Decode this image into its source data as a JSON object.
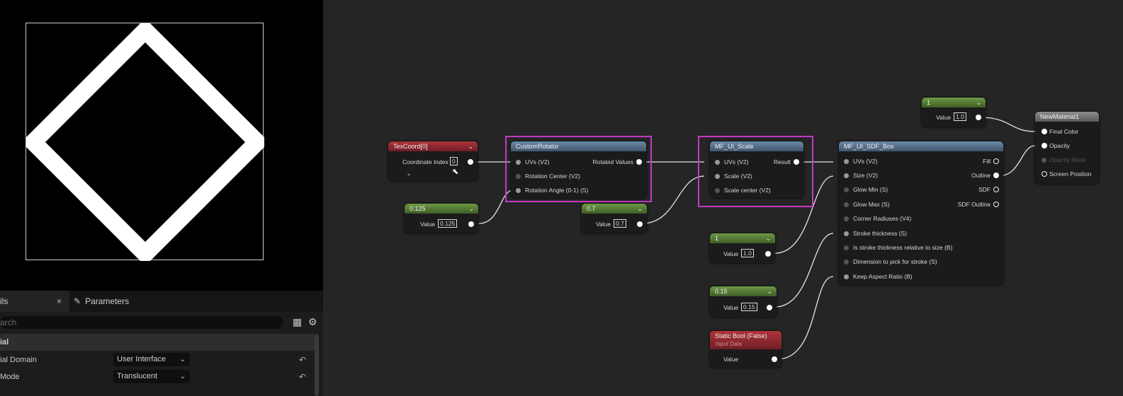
{
  "details_panel": {
    "tab_details": "ils",
    "tab_close": "×",
    "tab_parameters": "Parameters",
    "search_placeholder": "arch",
    "section": "ial",
    "rows": [
      {
        "label": "ial Domain",
        "value": "User Interface"
      },
      {
        "label": "Mode",
        "value": "Translucent"
      }
    ]
  },
  "nodes": {
    "texcoord": {
      "title": "TexCoord[0]",
      "pin": "Coordinate Index",
      "value": "0",
      "expand": "⌄"
    },
    "custom_rotator": {
      "title": "CustomRotator",
      "inputs": [
        "UVs (V2)",
        "Rotation Center (V2)",
        "Rotation Angle (0-1) (S)"
      ],
      "output": "Rotated Values"
    },
    "const_0125": {
      "title": "0.125",
      "pin": "Value",
      "value": "0.125"
    },
    "const_07": {
      "title": "0.7",
      "pin": "Value",
      "value": "0.7"
    },
    "mf_ui_scale": {
      "title": "MF_UI_Scale",
      "inputs": [
        "UVs (V2)",
        "Scale (V2)",
        "Scale center (V2)"
      ],
      "output": "Result"
    },
    "mf_ui_sdf_box": {
      "title": "MF_UI_SDF_Box",
      "inputs": [
        "UVs (V2)",
        "Size (V2)",
        "Glow Min (S)",
        "Glow Max (S)",
        "Corner Radiuses (V4)",
        "Stroke thickness (S)",
        "Is stroke thickness relative to size (B)",
        "Dimension to pick for stroke (S)",
        "Keep Aspect Ratio (B)"
      ],
      "outputs": [
        "Fill",
        "Outline",
        "SDF",
        "SDF Outline"
      ]
    },
    "const_1a": {
      "title": "1",
      "pin": "Value",
      "value": "1.0"
    },
    "const_1b": {
      "title": "1",
      "pin": "Value",
      "value": "1.0"
    },
    "const_015": {
      "title": "0.15",
      "pin": "Value",
      "value": "0.15"
    },
    "static_bool": {
      "title": "Static Bool (False)",
      "subtitle": "Input Data",
      "pin": "Value"
    },
    "material": {
      "title": "NewMaterial1",
      "inputs": [
        "Final Color",
        "Opacity",
        "Opacity Mask",
        "Screen Position"
      ]
    }
  },
  "colors": {
    "selection": "#c43ac4",
    "red_header": "#b0343a",
    "green_header": "#6d9a45",
    "blue_header": "#6b8aa8"
  },
  "icons": {
    "close": "close-icon",
    "parameters": "pencil-icon",
    "grid": "grid-icon",
    "settings": "gear-icon",
    "dropdown": "chevron-down-icon",
    "reset": "reset-arrow-icon"
  }
}
